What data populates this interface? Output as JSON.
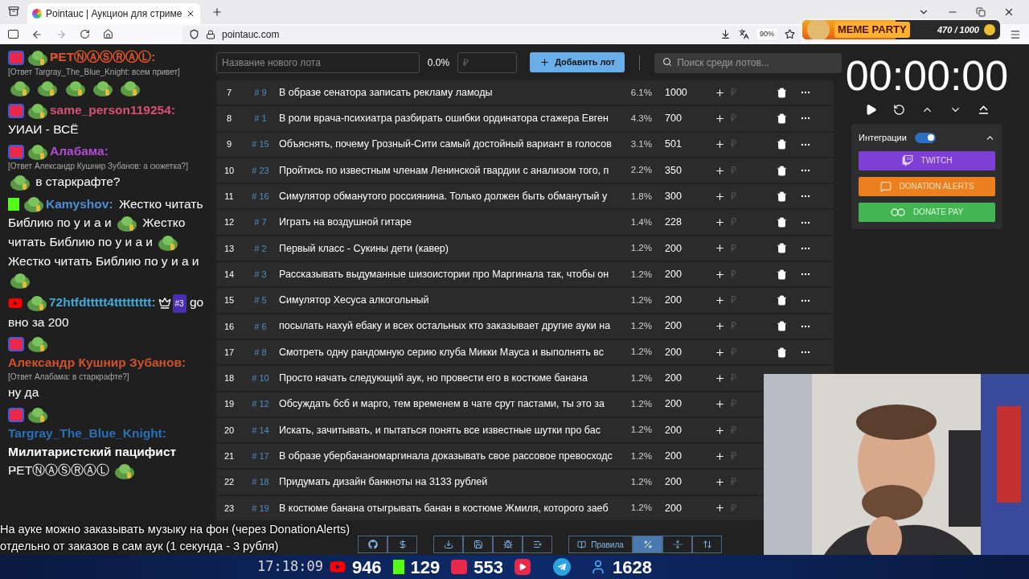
{
  "browser": {
    "tab_title": "Pointauc | Аукцион для стриме",
    "url": "pointauc.com",
    "zoom": "90%"
  },
  "meme_party": {
    "title": "MEME PARTY",
    "count": "470 / 1000",
    "level": 0.47
  },
  "chat": [
    {
      "kind": "live",
      "name": "ҎETⓃⒶⓈⓇⒶⓁ:",
      "color": "#e0532a",
      "reply": "[Ответ Targray_The_Blue_Knight: всем привет]",
      "parts": [
        {
          "kind": "emote"
        },
        {
          "kind": "emote"
        },
        {
          "kind": "emote"
        },
        {
          "kind": "emote"
        },
        {
          "kind": "emote"
        }
      ]
    },
    {
      "kind": "live",
      "name": "same_person119254:",
      "color": "#d9507a",
      "parts": [
        {
          "kind": "text",
          "text": "УИАИ - ВСЁ"
        }
      ]
    },
    {
      "kind": "live",
      "name": "Алабама:",
      "color": "#b44ad8",
      "reply": "[Ответ Александр Кушнир Зубанов: а сюжетка?]",
      "parts": [
        {
          "kind": "emote"
        },
        {
          "kind": "text",
          "text": "в старкрафте?"
        }
      ]
    },
    {
      "kind": "kick",
      "name": "Kamyshov:",
      "color": "#4a8fd8",
      "inline": true,
      "parts": [
        {
          "kind": "text",
          "text": "Жестко читать"
        },
        {
          "kind": "text",
          "text": "Библию по у и а и"
        },
        {
          "kind": "emote"
        },
        {
          "kind": "text",
          "text": "Жестко"
        },
        {
          "kind": "text",
          "text": "читать Библию по у и а и"
        },
        {
          "kind": "emote"
        },
        {
          "kind": "text",
          "text": "Жестко читать Библию по у и"
        },
        {
          "kind": "text",
          "text": "а и"
        },
        {
          "kind": "emote"
        }
      ]
    },
    {
      "kind": "youtube",
      "name": "72htfdttttt4ttttttttt:",
      "color": "#3fa9d8",
      "inline": true,
      "rank": "#3",
      "parts": [
        {
          "kind": "text",
          "text": "go"
        },
        {
          "kind": "text",
          "text": "вно за 200"
        }
      ]
    },
    {
      "kind": "live",
      "name": "Александр Кушнир Зубанов:",
      "color": "#d0522d",
      "reply": "[Ответ Алабама: в старкрафте?]",
      "parts": [
        {
          "kind": "text",
          "text": "ну да"
        }
      ]
    },
    {
      "kind": "live",
      "name": "Targray_The_Blue_Knight:",
      "color": "#2a70b8",
      "parts": [
        {
          "kind": "bold",
          "text": "Милитаристский пацифист"
        },
        {
          "kind": "text",
          "text": "ҎETⓃⒶⓈⓇⒶⓁ"
        },
        {
          "kind": "emote"
        }
      ]
    }
  ],
  "new_lot": {
    "name_placeholder": "Название нового лота",
    "percent": "0.0%",
    "amount_placeholder": "₽",
    "add_button": "Добавить лот"
  },
  "search": {
    "placeholder": "Поиск среди лотов..."
  },
  "lots": [
    {
      "index": "7",
      "id": "# 9",
      "name": "В образе сенатора записать рекламу ламоды",
      "percent": "6.1%",
      "amount": "1000",
      "currency": "₽",
      "tools_shown": true
    },
    {
      "index": "8",
      "id": "# 1",
      "name": "В роли врача-психиатра разбирать ошибки ординатора стажера Евген",
      "percent": "4.3%",
      "amount": "700",
      "currency": "₽",
      "tools_shown": true
    },
    {
      "index": "9",
      "id": "# 15",
      "name": "Объяснять, почему Грозный-Сити самый достойный вариант в голосов",
      "percent": "3.1%",
      "amount": "501",
      "currency": "₽",
      "tools_shown": true
    },
    {
      "index": "10",
      "id": "# 23",
      "name": "Пройтись по известным членам Ленинской гвардии с анализом того, п",
      "percent": "2.2%",
      "amount": "350",
      "currency": "₽",
      "tools_shown": true
    },
    {
      "index": "11",
      "id": "# 16",
      "name": "Симулятор обманутого россиянина. Только должен быть обманутый у",
      "percent": "1.8%",
      "amount": "300",
      "currency": "₽",
      "tools_shown": true
    },
    {
      "index": "12",
      "id": "# 7",
      "name": "Играть на воздушной гитаре",
      "percent": "1.4%",
      "amount": "228",
      "currency": "₽",
      "tools_shown": true
    },
    {
      "index": "13",
      "id": "# 2",
      "name": "Первый класс - Сукины дети (кавер)",
      "percent": "1.2%",
      "amount": "200",
      "currency": "₽",
      "tools_shown": true
    },
    {
      "index": "14",
      "id": "# 3",
      "name": "Рассказывать выдуманные шизоистории про Маргинала так, чтобы он",
      "percent": "1.2%",
      "amount": "200",
      "currency": "₽",
      "tools_shown": true
    },
    {
      "index": "15",
      "id": "# 5",
      "name": "Симулятор Хесуса алкогольный",
      "percent": "1.2%",
      "amount": "200",
      "currency": "₽",
      "tools_shown": true
    },
    {
      "index": "16",
      "id": "# 6",
      "name": "посылать нахуй ебаку и всех остальных кто заказывает другие ауки на",
      "percent": "1.2%",
      "amount": "200",
      "currency": "₽",
      "tools_shown": true
    },
    {
      "index": "17",
      "id": "# 8",
      "name": "Смотреть одну рандомную серию клуба Микки Мауса и выполнять вс",
      "percent": "1.2%",
      "amount": "200",
      "currency": "₽",
      "tools_shown": true
    },
    {
      "index": "18",
      "id": "# 10",
      "name": "Просто начать следующий аук, но провести его в костюме банана",
      "percent": "1.2%",
      "amount": "200",
      "currency": "₽"
    },
    {
      "index": "19",
      "id": "# 12",
      "name": "Обсуждать бсб и марго, тем временем в чате срут пастами, ты это за",
      "percent": "1.2%",
      "amount": "200",
      "currency": "₽"
    },
    {
      "index": "20",
      "id": "# 14",
      "name": "Искать, зачитывать, и пытаться понять все известные шутки про бас",
      "percent": "1.2%",
      "amount": "200",
      "currency": "₽"
    },
    {
      "index": "21",
      "id": "# 17",
      "name": "В образе убербананомаргинала доказывать свое рассовое превосходс",
      "percent": "1.2%",
      "amount": "200",
      "currency": "₽"
    },
    {
      "index": "22",
      "id": "# 18",
      "name": "Придумать дизайн банкноты на 3133 рублей",
      "percent": "1.2%",
      "amount": "200",
      "currency": "₽"
    },
    {
      "index": "23",
      "id": "# 19",
      "name": "В костюме банана отыгрывать банан в костюме Жмиля, которого заеб",
      "percent": "1.2%",
      "amount": "200",
      "currency": "₽"
    }
  ],
  "timer": "00:00:00",
  "integrations": {
    "label": "Интеграции",
    "on": true,
    "expanded": true,
    "buttons": [
      {
        "kind": "twitch",
        "label": "TWITCH"
      },
      {
        "kind": "donationalerts",
        "label": "DONATION ALERTS"
      },
      {
        "kind": "donatepay",
        "label": "DONATE PAY"
      }
    ]
  },
  "toolbar": {
    "rules": "Правила",
    "percent_selected": true
  },
  "caption": [
    "На ауке можно заказывать музыку на фон (через DonationAlerts)",
    "отдельно от заказов в сам аук (1 секунда - 3 рубля)"
  ],
  "stream_bar": {
    "time": "17:18:09",
    "youtube": "946",
    "kick": "129",
    "live": "553",
    "viewers": "1628"
  },
  "webcam": {
    "kind": "picture"
  }
}
